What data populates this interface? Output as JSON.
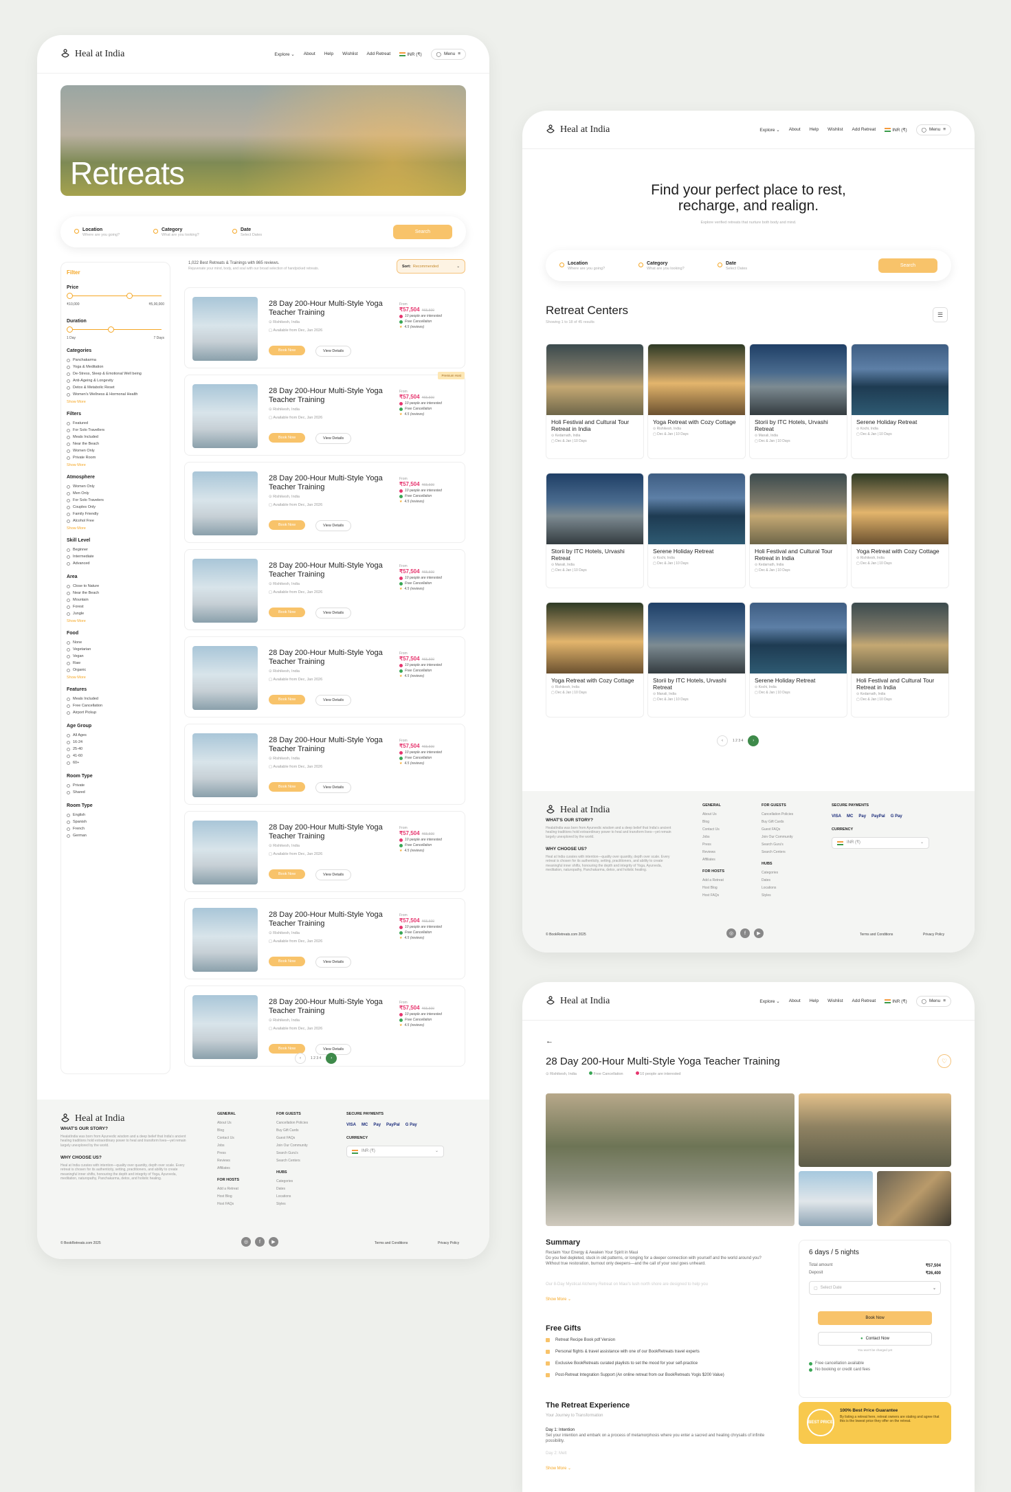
{
  "brand": "Heal at India",
  "nav": {
    "explore": "Explore",
    "about": "About",
    "help": "Help",
    "wishlist": "Wishlist",
    "add_retreat": "Add Retreat",
    "currency": "INR (₹)",
    "menu": "Menu"
  },
  "hero": {
    "title": "Retreats"
  },
  "search": {
    "location_label": "Location",
    "location_ph": "Where are you going?",
    "category_label": "Category",
    "category_ph": "What are you looking?",
    "date_label": "Date",
    "date_ph": "Select Dates",
    "button": "Search"
  },
  "filters": {
    "title": "Filter",
    "price_label": "Price",
    "price_min": "₹10,000",
    "price_max": "₹5,00,000",
    "price_range": [
      0.0,
      0.65
    ],
    "duration_label": "Duration",
    "duration_min": "1 Day",
    "duration_max": "7 Days",
    "duration_range": [
      0.0,
      0.45
    ],
    "show_more": "Show More",
    "sections": [
      {
        "title": "Categories",
        "options": [
          "Panchakarma",
          "Yoga & Meditation",
          "De-Stress, Sleep & Emotional Well being",
          "Anti-Ageing & Longevity",
          "Detox & Metabolic Reset",
          "Women's Wellness & Hormonal Health"
        ],
        "more": true
      },
      {
        "title": "Filters",
        "options": [
          "Featured",
          "For Solo Travellers",
          "Meals Included",
          "Near the Beach",
          "Women Only",
          "Private Room"
        ],
        "more": true
      },
      {
        "title": "Atmosphere",
        "options": [
          "Women Only",
          "Men Only",
          "For Solo Travelers",
          "Couples Only",
          "Family Friendly",
          "Alcohol Free"
        ],
        "more": true
      },
      {
        "title": "Skill Level",
        "options": [
          "Beginner",
          "Intermediate",
          "Advanced"
        ],
        "more": false
      },
      {
        "title": "Area",
        "options": [
          "Close to Nature",
          "Near the Beach",
          "Mountain",
          "Forest",
          "Jungle"
        ],
        "more": true
      },
      {
        "title": "Food",
        "options": [
          "None",
          "Vegetarian",
          "Vegan",
          "Raw",
          "Organic"
        ],
        "more": true
      },
      {
        "title": "Features",
        "options": [
          "Meals Included",
          "Free Cancellation",
          "Airport Pickup"
        ],
        "more": false
      },
      {
        "title": "Age Group",
        "options": [
          "All Ages",
          "16-24",
          "25-40",
          "41-60",
          "60+"
        ],
        "more": false
      },
      {
        "title": "Room Type",
        "options": [
          "Private",
          "Shared"
        ],
        "more": false
      },
      {
        "title": "Room Type",
        "options": [
          "English",
          "Spanish",
          "French",
          "German"
        ],
        "more": false
      }
    ]
  },
  "results": {
    "count": "1,022 Best Retreats & Trainings with 865 reviews.",
    "sub": "Rejuvenate your mind, body, and soul with our broad selection of handpicked retreats."
  },
  "sort": {
    "label": "Sort:",
    "value": "Recommended"
  },
  "listing": {
    "title": "28 Day 200-Hour Multi-Style Yoga Teacher Training",
    "location": "Rishikesh, India",
    "available": "Available from Dec, Jan 2026",
    "from": "From",
    "price": "₹57,504",
    "old_price": "₹65,500",
    "interest": "10 people are interested",
    "cancellation": "Free Cancellation",
    "rating": "4.5 (reviews)",
    "book": "Book Now",
    "view": "View Details",
    "premium": "Premium Host"
  },
  "pager": {
    "pages": "1  2  3  4"
  },
  "footer": {
    "story_title": "WHAT'S OUR STORY?",
    "story": "HealatIndia was born from Ayurvedic wisdom and a deep belief that India's ancient healing traditions hold extraordinary power to heal and transform lives—yet remain largely unexplored by the world.",
    "why_title": "WHY CHOOSE US?",
    "why": "Heal at India curates with intention—quality over quantity, depth over scale. Every retreat is chosen for its authenticity, setting, practitioners, and ability to create meaningful inner shifts, honouring the depth and integrity of Yoga, Ayurveda, meditation, naturopathy, Panchakarma, detox, and holistic healing.",
    "general_title": "GENERAL",
    "general": [
      "About Us",
      "Blog",
      "Contact Us",
      "Jobs",
      "Press",
      "Reviews",
      "Affiliates"
    ],
    "hosts_title": "FOR HOSTS",
    "hosts": [
      "Add a Retreat",
      "Host Blog",
      "Host FAQs"
    ],
    "guests_title": "FOR GUESTS",
    "guests": [
      "Cancellation Policies",
      "Buy Gift Cards",
      "Guest FAQs",
      "Join Our Community",
      "Search Guru's",
      "Search Centers"
    ],
    "hubs_title": "HUBS",
    "hubs": [
      "Categories",
      "Dates",
      "Locations",
      "Styles"
    ],
    "payments_title": "SECURE PAYMENTS",
    "payments": [
      "VISA",
      "MC",
      "Pay",
      "PayPal",
      "G Pay"
    ],
    "currency_title": "CURRENCY",
    "currency": "INR (₹)",
    "copyright": "© BookRetreats.com 2025",
    "terms": "Terms and Conditions",
    "privacy": "Privacy Policy"
  },
  "centers": {
    "headline1": "Find your perfect place to rest,",
    "headline2": "recharge, and realign.",
    "tagline": "Explore verified retreats that nurture both body and mind.",
    "title": "Retreat Centers",
    "showing": "Showing 1 to 18 of 45 results",
    "items": [
      {
        "name": "Holi Festival and Cultural Tour Retreat in India",
        "loc": "Kedarnath, India",
        "when": "Dec & Jan | 10 Days",
        "img": "bg1"
      },
      {
        "name": "Yoga Retreat with Cozy Cottage",
        "loc": "Rishikesh, India",
        "when": "Dec & Jan | 10 Days",
        "img": "bg2"
      },
      {
        "name": "Storii by ITC Hotels, Urvashi Retreat",
        "loc": "Manali, India",
        "when": "Dec & Jan | 10 Days",
        "img": "bg3"
      },
      {
        "name": "Serene Holiday Retreat",
        "loc": "Kochi, India",
        "when": "Dec & Jan | 10 Days",
        "img": "bg4"
      },
      {
        "name": "Storii by ITC Hotels, Urvashi Retreat",
        "loc": "Manali, India",
        "when": "Dec & Jan | 10 Days",
        "img": "bg3"
      },
      {
        "name": "Serene Holiday Retreat",
        "loc": "Kochi, India",
        "when": "Dec & Jan | 10 Days",
        "img": "bg4"
      },
      {
        "name": "Holi Festival and Cultural Tour Retreat in India",
        "loc": "Kedarnath, India",
        "when": "Dec & Jan | 10 Days",
        "img": "bg1"
      },
      {
        "name": "Yoga Retreat with Cozy Cottage",
        "loc": "Rishikesh, India",
        "when": "Dec & Jan | 10 Days",
        "img": "bg2"
      },
      {
        "name": "Yoga Retreat with Cozy Cottage",
        "loc": "Rishikesh, India",
        "when": "Dec & Jan | 10 Days",
        "img": "bg2"
      },
      {
        "name": "Storii by ITC Hotels, Urvashi Retreat",
        "loc": "Manali, India",
        "when": "Dec & Jan | 10 Days",
        "img": "bg3"
      },
      {
        "name": "Serene Holiday Retreat",
        "loc": "Kochi, India",
        "when": "Dec & Jan | 10 Days",
        "img": "bg4"
      },
      {
        "name": "Holi Festival and Cultural Tour Retreat in India",
        "loc": "Kedarnath, India",
        "when": "Dec & Jan | 10 Days",
        "img": "bg1"
      }
    ]
  },
  "detail": {
    "title": "28 Day 200-Hour Multi-Style Yoga Teacher Training",
    "location": "Rishikesh, India",
    "cancel": "Free Cancellation",
    "interest": "10 people are interested",
    "summary_title": "Summary",
    "summary": "Reclaim Your Energy & Awaken Your Spirit in Maui\nDo you feel depleted, stuck in old patterns, or longing for a deeper connection with yourself and the world around you?\nWithout true restoration, burnout only deepens—and the call of your soul goes unheard.",
    "summary_fade": "Our 8-Day Mystical Alchemy Retreat on Maui's lush north shore are designed to help you",
    "show_more": "Show More",
    "gifts_title": "Free Gifts",
    "gifts": [
      "Retreat Recipe Book pdf Version",
      "Personal flights & travel assistance with one of our BookRetreats travel experts",
      "Exclusive BookRetreats curated playlists to set the mood for your self-practice",
      "Post-Retreat Integration Support (An online retreat from our BookRetreats Yogis $200 Value)"
    ],
    "exp_title": "The Retreat Experience",
    "exp_sub": "Your Journey to Transformation",
    "day1": "Day 1: Intention",
    "day1_text": "Set your intention and embark on a process of metamorphosis where you enter a sacred and healing chrysalis of infinite possibility.",
    "day2": "Day 2: Melt",
    "stay": "6 days / 5 nights",
    "total_label": "Total amount",
    "total": "₹57,504",
    "deposit_label": "Deposit",
    "deposit": "₹26,400",
    "date_ph": "Select Date",
    "book": "Book Now",
    "contact": "Contact Now",
    "charge_note": "You won't be charged yet",
    "perk1": "Free cancellation available",
    "perk2": "No booking or credit card fees",
    "promo_title": "100% Best Price Guarantee",
    "promo_text": "By listing a retreat here, retreat owners are stating and agree that this is the lowest price they offer on the retreat.",
    "seal": "BEST PRICE"
  }
}
